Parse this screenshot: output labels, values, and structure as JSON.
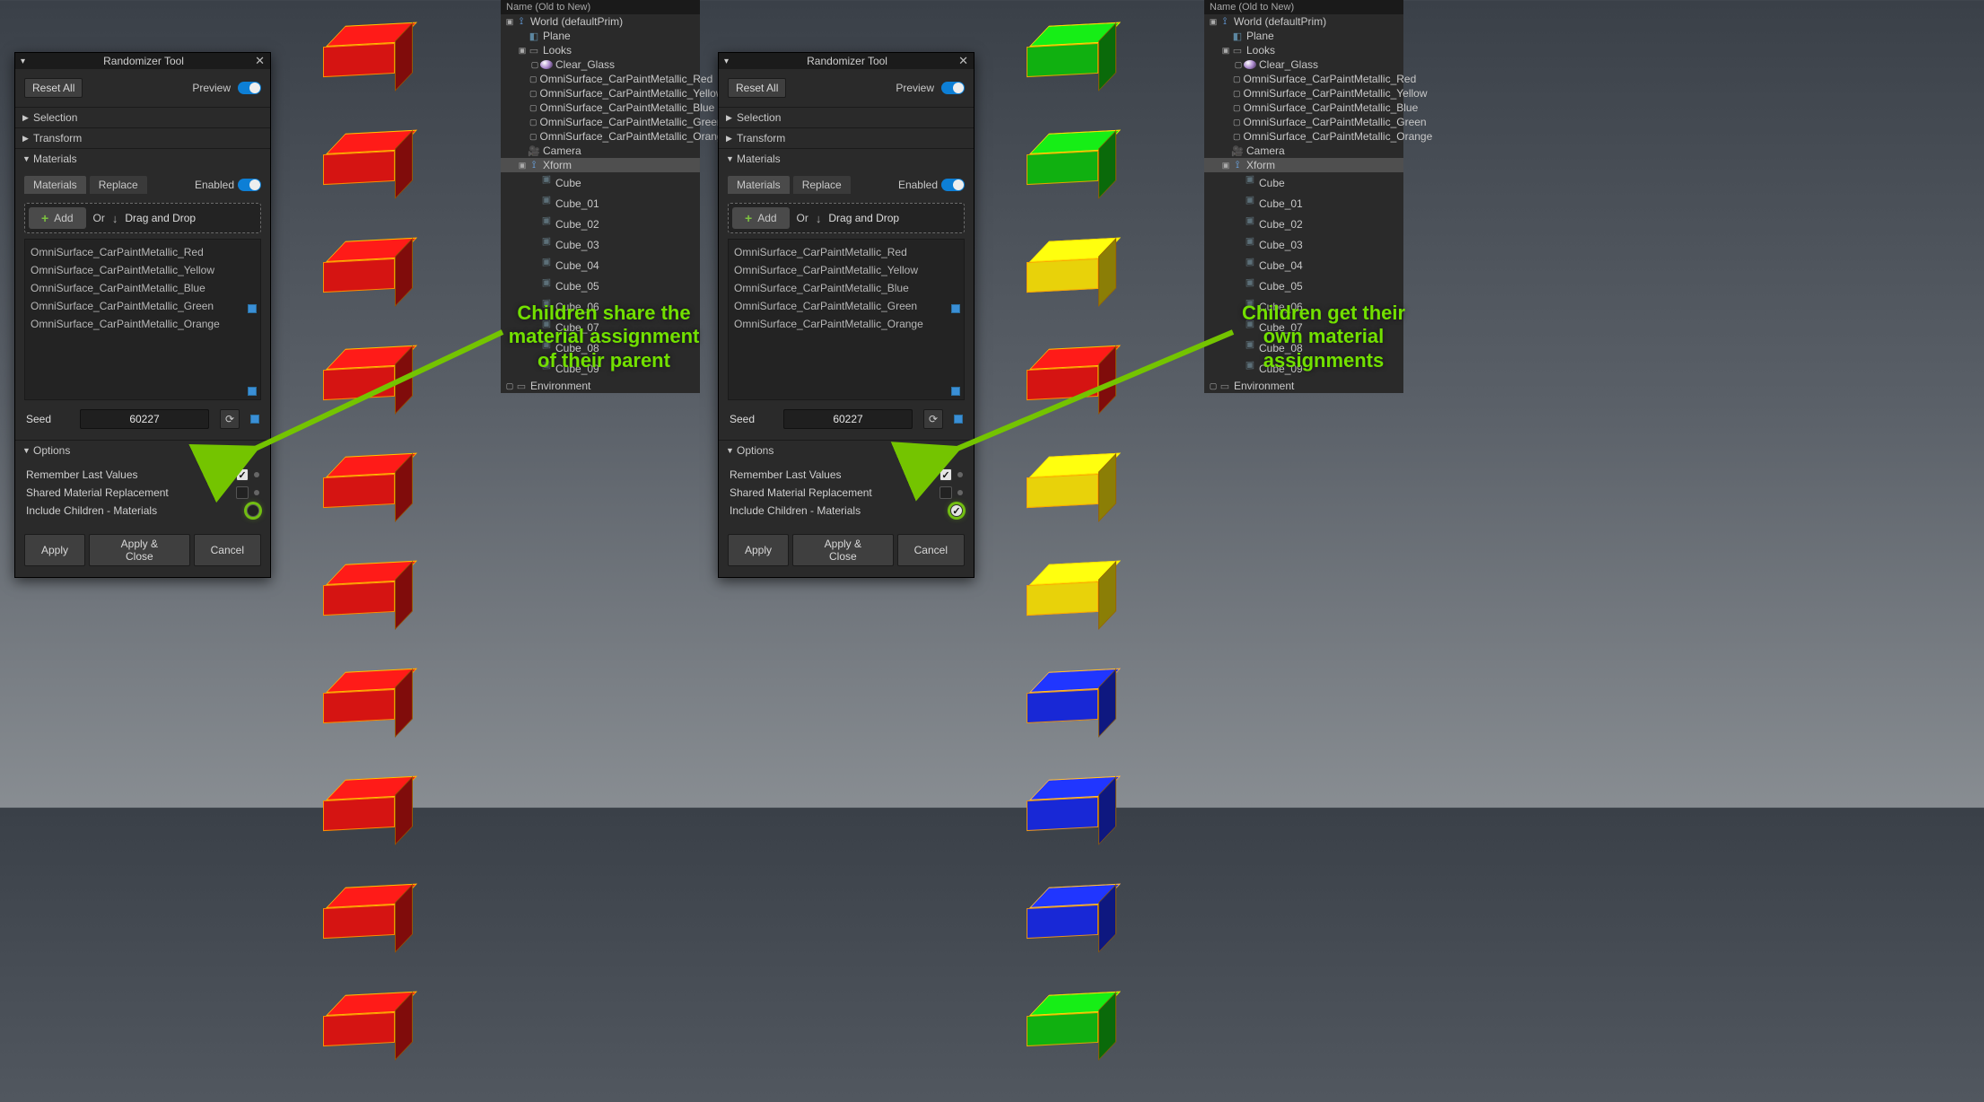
{
  "panel": {
    "title": "Randomizer Tool",
    "reset": "Reset All",
    "preview": "Preview",
    "sections": {
      "selection": "Selection",
      "transform": "Transform",
      "materials": "Materials",
      "options": "Options"
    },
    "materials": {
      "tab_materials": "Materials",
      "tab_replace": "Replace",
      "enabled": "Enabled",
      "add": "Add",
      "or": "Or",
      "dnd": "Drag and Drop",
      "items": [
        "OmniSurface_CarPaintMetallic_Red",
        "OmniSurface_CarPaintMetallic_Yellow",
        "OmniSurface_CarPaintMetallic_Blue",
        "OmniSurface_CarPaintMetallic_Green",
        "OmniSurface_CarPaintMetallic_Orange"
      ]
    },
    "seed": {
      "label": "Seed",
      "value": "60227"
    },
    "options": {
      "remember": "Remember Last Values",
      "shared": "Shared Material Replacement",
      "include_children": "Include Children - Materials"
    },
    "buttons": {
      "apply": "Apply",
      "apply_close": "Apply & Close",
      "cancel": "Cancel"
    }
  },
  "tree": {
    "head": "Name (Old to New)",
    "world": "World (defaultPrim)",
    "plane": "Plane",
    "looks": "Looks",
    "mats": [
      "Clear_Glass",
      "OmniSurface_CarPaintMetallic_Red",
      "OmniSurface_CarPaintMetallic_Yellow",
      "OmniSurface_CarPaintMetallic_Blue",
      "OmniSurface_CarPaintMetallic_Green",
      "OmniSurface_CarPaintMetallic_Orange"
    ],
    "camera": "Camera",
    "xform": "Xform",
    "cubes": [
      "Cube",
      "Cube_01",
      "Cube_02",
      "Cube_03",
      "Cube_04",
      "Cube_05",
      "Cube_06",
      "Cube_07",
      "Cube_08",
      "Cube_09"
    ],
    "environment": "Environment"
  },
  "left": {
    "include_children_checked": false,
    "cube_colors": [
      "red",
      "red",
      "red",
      "red",
      "red",
      "red",
      "red",
      "red",
      "red",
      "red"
    ],
    "annot": "Children share the\nmaterial assignment\nof their parent"
  },
  "right": {
    "include_children_checked": true,
    "cube_colors": [
      "green",
      "green",
      "yellow",
      "red",
      "yellow",
      "yellow",
      "blue",
      "blue",
      "blue",
      "green"
    ],
    "annot": "Children get their\nown material\nassignments"
  }
}
